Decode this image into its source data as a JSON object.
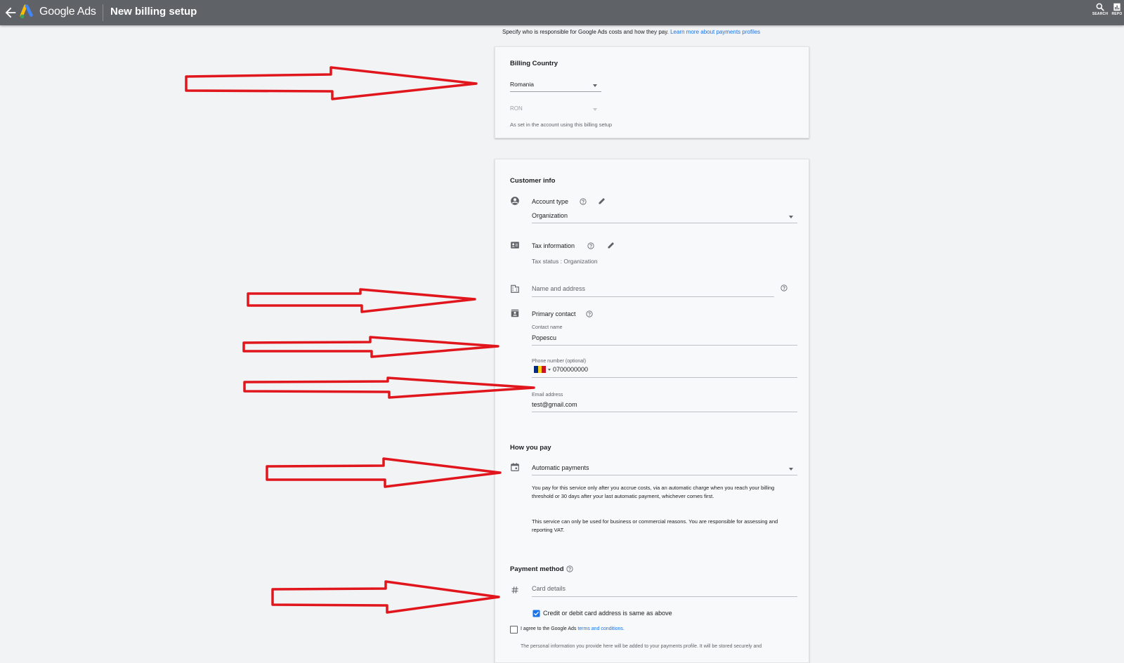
{
  "header": {
    "brand": "Google Ads",
    "title": "New billing setup",
    "tools": [
      {
        "label": "SEARCH",
        "icon": "search-icon"
      },
      {
        "label": "REPO",
        "icon": "reports-icon"
      }
    ]
  },
  "intro": {
    "text": "Specify who is responsible for Google Ads costs and how they pay.",
    "link": "Learn more about payments profiles"
  },
  "billing_country": {
    "heading": "Billing Country",
    "country": "Romania",
    "currency": "RON",
    "note": "As set in the account using this billing setup"
  },
  "customer_info": {
    "heading": "Customer info",
    "account_type_label": "Account type",
    "account_type_value": "Organization",
    "tax_label": "Tax information",
    "tax_status": "Tax status : Organization",
    "name_address_placeholder": "Name and address",
    "primary_contact_label": "Primary contact",
    "contact_name_label": "Contact name",
    "contact_name_value": "Popescu",
    "phone_label": "Phone number (optional)",
    "phone_value": "0700000000",
    "email_label": "Email address",
    "email_value": "test@gmail.com"
  },
  "how_you_pay": {
    "heading": "How you pay",
    "selected": "Automatic payments",
    "description": "You pay for this service only after you accrue costs, via an automatic charge when you reach your billing threshold or 30 days after your last automatic payment, whichever comes first.",
    "vat_note": "This service can only be used for business or commercial reasons. You are responsible for assessing and reporting VAT."
  },
  "payment_method": {
    "heading": "Payment method",
    "card_placeholder": "Card details",
    "same_address_label": "Credit or debit card address is same as above",
    "same_address_checked": true,
    "agree_prefix": "I agree to the Google Ads",
    "agree_link": "terms and conditions.",
    "agree_checked": false,
    "footer_cutoff": "The personal information you provide here will be added to your payments profile. It will be stored securely and"
  },
  "colors": {
    "topbar": "#5f6368",
    "background": "#f2f3f5",
    "card": "#f8f9fa",
    "link": "#1a73e8",
    "annotation_arrow": "#e0161c"
  }
}
